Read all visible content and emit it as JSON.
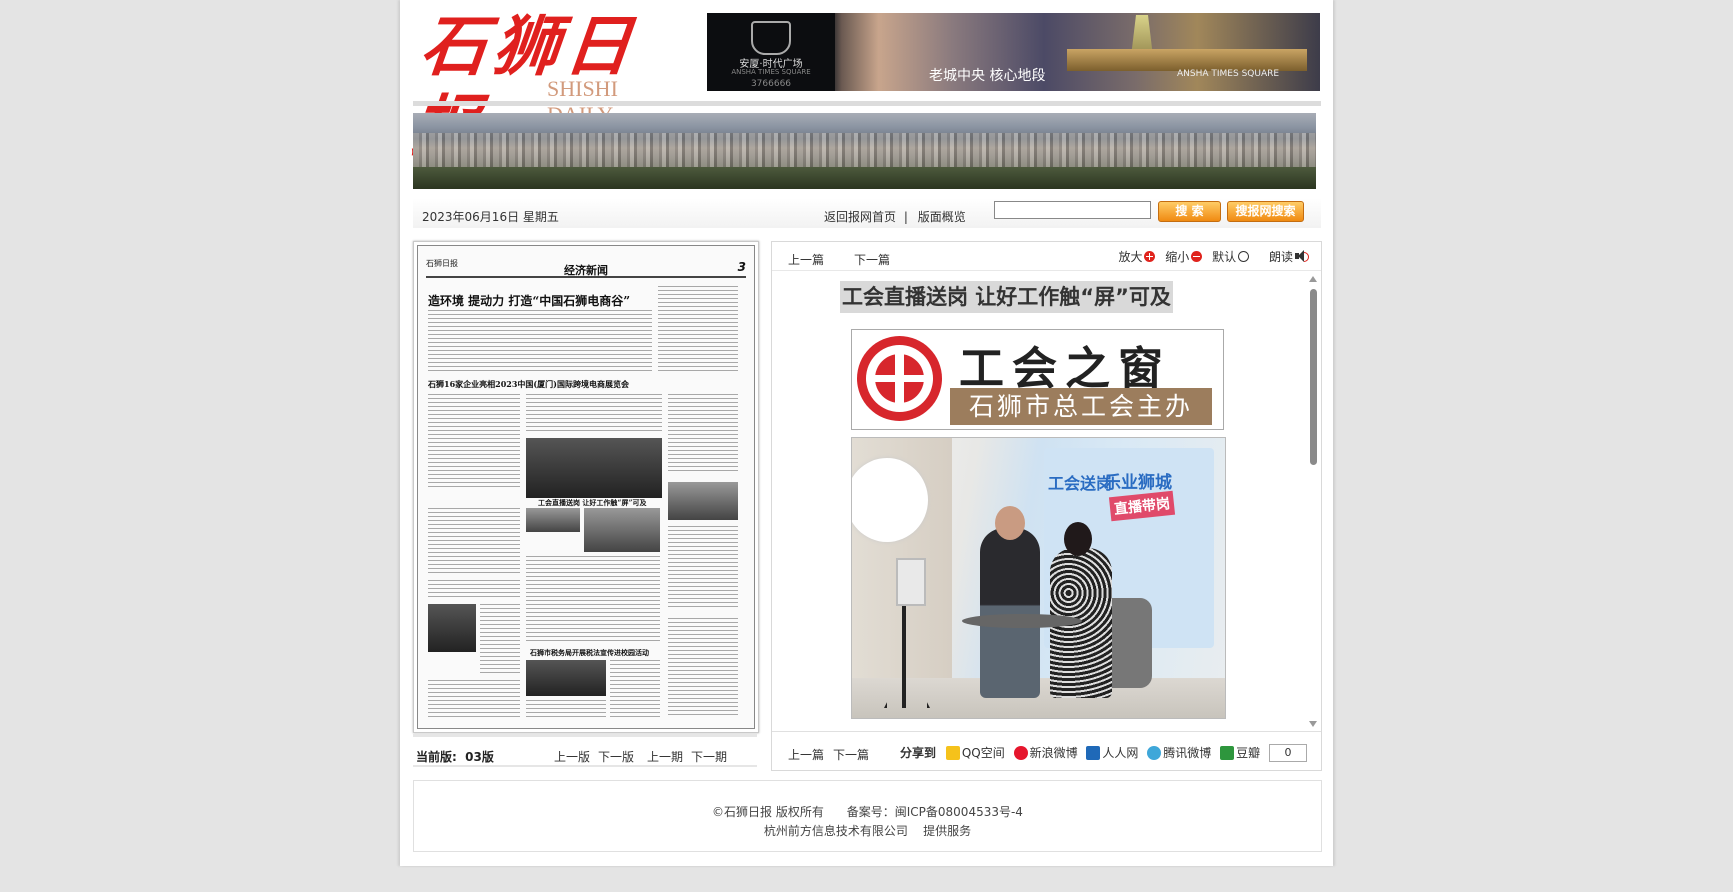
{
  "masthead": {
    "title_cn": "石狮日报",
    "title_en": "SHISHI DAILY"
  },
  "ad": {
    "brand": "安厦·时代广场",
    "brand_en": "ANSHA TIMES SQUARE",
    "phone": "3766666",
    "slogan": "老城中央  核心地段",
    "slogan_en": "ANSHA  TIMES SQUARE"
  },
  "toolbar": {
    "date": "2023年06月16日 星期五",
    "home_link": "返回报网首页",
    "separator": "|",
    "overview_link": "版面概览",
    "search_placeholder": "",
    "search_button": "搜 索",
    "site_search_button": "搜报网搜索"
  },
  "paper": {
    "logo": "石狮日报",
    "section": "经济新闻",
    "page_no": "3",
    "headline1": "造环境 提动力 打造“中国石狮电商谷”",
    "headline2": "石狮16家企业亮相2023中国(厦门)国际跨境电商展览会",
    "headline3": "工会直播送岗 让好工作触“屏”可及",
    "headline4": "石狮市税务局开展税法宣传进校园活动"
  },
  "pager": {
    "current_label": "当前版:",
    "current_value": "03版",
    "prev_edition": "上一版",
    "next_edition": "下一版",
    "prev_issue": "上一期",
    "next_issue": "下一期"
  },
  "article": {
    "prev": "上一篇",
    "next": "下一篇",
    "zoom_in": "放大",
    "zoom_out": "缩小",
    "default": "默认",
    "read": "朗读",
    "title": "工会直播送岗 让好工作触“屏”可及",
    "banner_title": "工会之窗",
    "banner_sub": "石狮市总工会主办",
    "photo_board1": "工会送岗",
    "photo_board2": "乐业狮城",
    "photo_tag": "直播带岗"
  },
  "share": {
    "label": "分享到",
    "items": [
      "QQ空间",
      "新浪微博",
      "人人网",
      "腾讯微博",
      "豆瓣"
    ],
    "count": "0"
  },
  "footer": {
    "line1": "©石狮日报 版权所有      备案号：闽ICP备08004533号-4",
    "line2": "杭州前方信息技术有限公司    提供服务"
  },
  "colors": {
    "brand_red": "#e0201e",
    "button_orange": "#f08a12",
    "union_red": "#d7262c",
    "union_brown": "#9c7d5d"
  }
}
